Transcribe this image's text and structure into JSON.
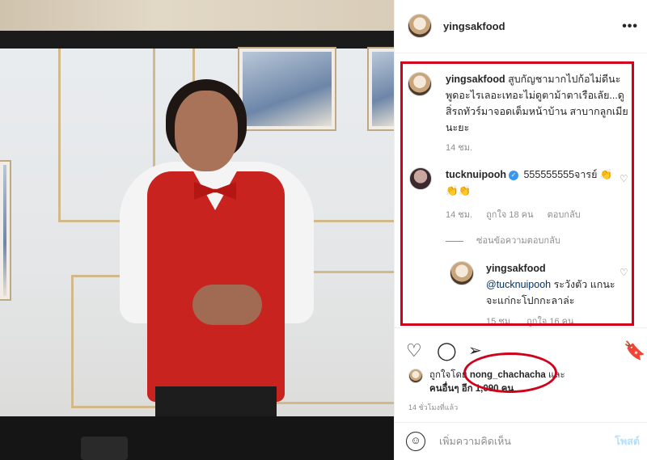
{
  "post": {
    "author": "yingsakfood",
    "more_icon": "more-icon",
    "caption": {
      "username": "yingsakfood",
      "text": "สูบกัญชามากไปก้อไม่ดีนะ พูดอะไรเลอะเทอะไม่ดูตาม้าตาเรือเลัย...ดู สิ่รถทัวร์มาจอดเต็มหน้าบ้าน สาบากลูกเมีย นะยะ",
      "time": "14 ชม."
    },
    "comments": [
      {
        "username": "tucknuipooh",
        "verified_icon": "verified-badge-icon",
        "text": "555555555จารย์ 👏👏👏",
        "time": "14 ชม.",
        "likes": "ถูกใจ 18 คน",
        "reply_label": "ตอบกลับ",
        "hide_replies": "ซ่อนข้อความตอบกลับ"
      }
    ],
    "reply": {
      "username": "yingsakfood",
      "mention": "@tucknuipooh",
      "text": " ระวังตัว แกนะจะแก่กะโปกกะลาล่ะ",
      "time": "15 ชม.",
      "likes": "ถูกใจ 16 คน"
    },
    "likes_line": {
      "prefix": "ถูกใจโดย",
      "user": "nong_chachacha",
      "suffix": " และ",
      "others": "คนอื่นๆ อีก 1,090 คน"
    },
    "time_ago": "14 ชั่วโมงที่แล้ว",
    "add_comment_placeholder": "เพิ่มความคิดเห็น",
    "post_button": "โพสต์"
  },
  "colors": {
    "highlight": "#d0021b",
    "verified": "#3897f0",
    "post_button": "#b2dffc"
  }
}
